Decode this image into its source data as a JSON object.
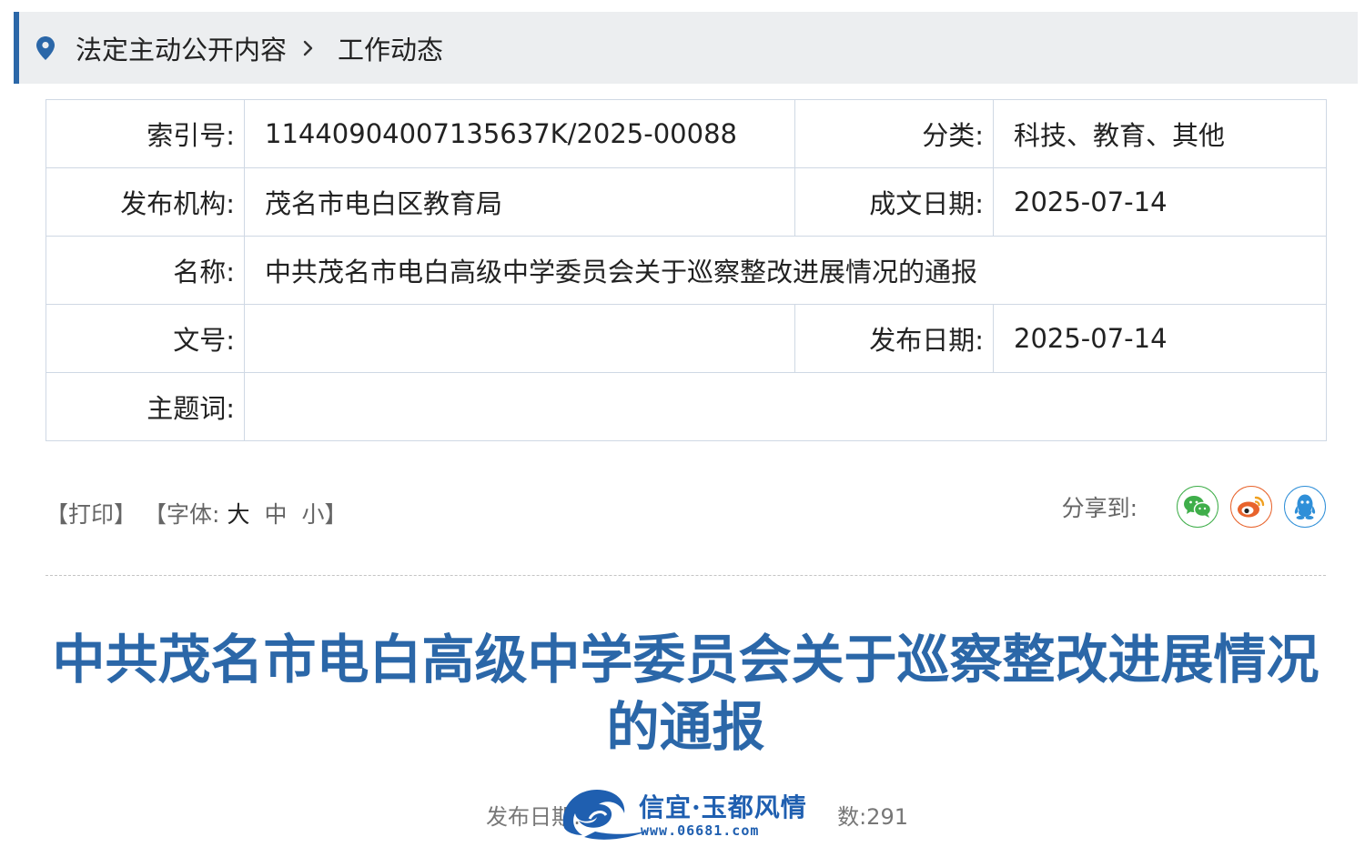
{
  "breadcrumb": {
    "items": [
      {
        "label": "法定主动公开内容"
      },
      {
        "label": "工作动态"
      }
    ],
    "icons": {
      "location": "location-pin-icon",
      "separator": "chevron-right-icon"
    },
    "accent": "#2b67a8"
  },
  "info": {
    "index_label": "索引号:",
    "index_value": "11440904007135637K/2025-00088",
    "category_label": "分类:",
    "category_value": "科技、教育、其他",
    "publisher_label": "发布机构:",
    "publisher_value": "茂名市电白区教育局",
    "written_date_label": "成文日期:",
    "written_date_value": "2025-07-14",
    "name_label": "名称:",
    "name_value": "中共茂名市电白高级中学委员会关于巡察整改进展情况的通报",
    "doc_no_label": "文号:",
    "doc_no_value": "",
    "publish_date_label": "发布日期:",
    "publish_date_value": "2025-07-14",
    "keywords_label": "主题词:",
    "keywords_value": ""
  },
  "toolbar": {
    "print": "【打印】",
    "font_prefix": "【字体:",
    "size_large": "大",
    "size_medium": "中",
    "size_small": "小",
    "font_suffix": "】",
    "share_label": "分享到:",
    "share_buttons": [
      {
        "icon": "wechat-icon",
        "color": "#3fae4a"
      },
      {
        "icon": "weibo-icon",
        "color": "#e8632c"
      },
      {
        "icon": "qq-icon",
        "color": "#2f8fd8"
      }
    ]
  },
  "article": {
    "title": "中共茂名市电白高级中学委员会关于巡察整改进展情况的通报",
    "meta_left": "发布日期:",
    "meta_right": "数:291"
  },
  "watermark": {
    "text": "信宜·玉都风情",
    "url": "www.06681.com"
  }
}
